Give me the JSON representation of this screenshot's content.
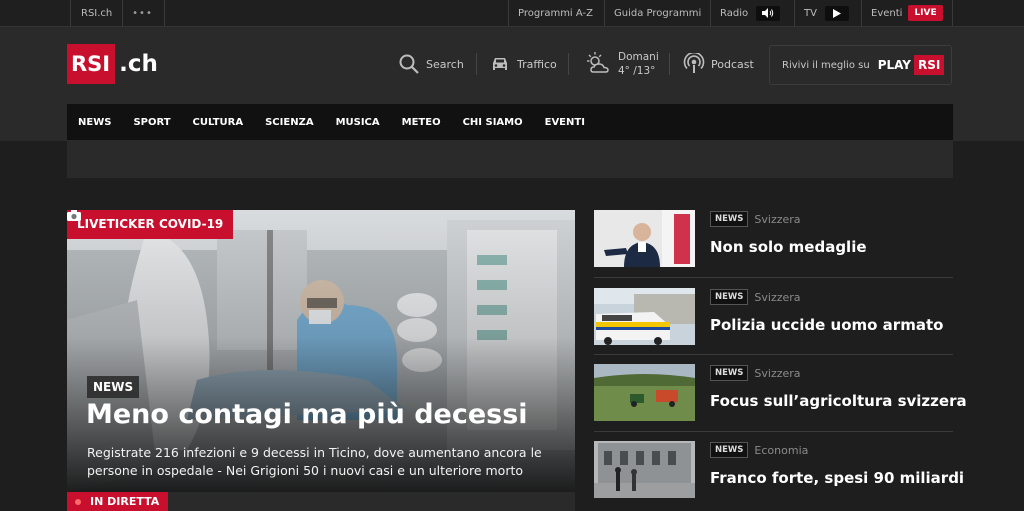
{
  "topbar": {
    "site": "RSI.ch",
    "more": "•••",
    "links": {
      "programmi": "Programmi A-Z",
      "guida": "Guida Programmi",
      "radio": "Radio",
      "tv": "TV",
      "eventi": "Eventi",
      "live": "LIVE"
    }
  },
  "header": {
    "logo_main": "RSI",
    "logo_suffix": ".ch",
    "search": "Search",
    "traffico": "Traffico",
    "meteo_day": "Domani",
    "meteo_temp": "4° /13°",
    "podcast": "Podcast",
    "promo_text": "Rivivi il meglio su",
    "promo_play": "PLAY",
    "promo_rsi": "RSI"
  },
  "nav": {
    "items": [
      "NEWS",
      "SPORT",
      "CULTURA",
      "SCIENZA",
      "MUSICA",
      "METEO",
      "CHI SIAMO",
      "EVENTI"
    ]
  },
  "hero": {
    "tag": "LIVETICKER COVID-19",
    "category": "NEWS",
    "title": "Meno contagi ma più decessi",
    "subtitle": "Registrate 216 infezioni e 9 decessi in Ticino, dove aumentano ancora le persone in ospedale - Nei Grigioni 50 i nuovi casi e un ulteriore morto"
  },
  "live": {
    "label": "IN DIRETTA"
  },
  "side_news": [
    {
      "category": "NEWS",
      "section": "Svizzera",
      "title": "Non solo medaglie"
    },
    {
      "category": "NEWS",
      "section": "Svizzera",
      "title": "Polizia uccide uomo armato"
    },
    {
      "category": "NEWS",
      "section": "Svizzera",
      "title": "Focus sull’agricoltura svizzera"
    },
    {
      "category": "NEWS",
      "section": "Economia",
      "title": "Franco forte, spesi 90 miliardi"
    }
  ],
  "colors": {
    "accent": "#c8102e",
    "background": "#1e1e1e",
    "header": "#2a2a2a",
    "nav": "#111111"
  },
  "icons": {
    "search": "search-icon",
    "traffico": "car-icon",
    "meteo": "cloud-sun-icon",
    "podcast": "podcast-icon",
    "radio": "speaker-icon",
    "tv": "play-icon",
    "camera": "camera-icon"
  }
}
